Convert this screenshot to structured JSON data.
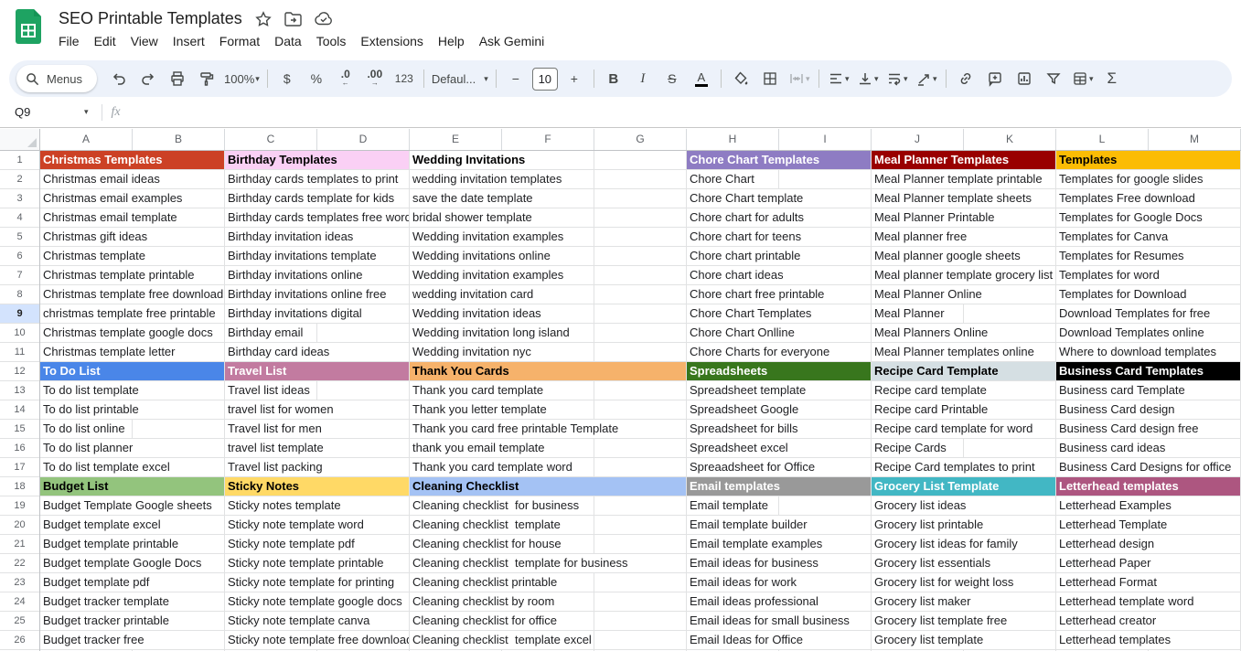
{
  "titlebar": {
    "title": "SEO Printable Templates",
    "menus": [
      "File",
      "Edit",
      "View",
      "Insert",
      "Format",
      "Data",
      "Tools",
      "Extensions",
      "Help",
      "Ask Gemini"
    ]
  },
  "toolbar": {
    "menus_label": "Menus",
    "zoom": "100%",
    "currency": "$",
    "percent": "%",
    "decrease_decimal": ".0",
    "increase_decimal": ".00",
    "more_formats": "123",
    "font_name": "Defaul...",
    "minus": "−",
    "font_size": "10",
    "plus": "+",
    "bold": "B",
    "italic": "I",
    "strikethrough": "S",
    "text_color": "A",
    "functions": "Σ"
  },
  "formula_bar": {
    "name_box": "Q9",
    "fx": "fx"
  },
  "grid": {
    "column_letters": [
      "A",
      "B",
      "C",
      "D",
      "E",
      "F",
      "G",
      "H",
      "I",
      "J",
      "K",
      "L",
      "M"
    ],
    "row_count": 26,
    "selected_row": 9,
    "groups": [
      {
        "col": 0,
        "span": 2,
        "headers": {
          "1": {
            "bg": "#cc4125",
            "fg": "#ffffff"
          },
          "12": {
            "bg": "#4a86e8",
            "fg": "#ffffff"
          },
          "18": {
            "bg": "#93c47d",
            "fg": "#000000"
          }
        },
        "cells": [
          "Christmas Templates",
          "Christmas email ideas",
          "Christmas email examples",
          "Christmas email template",
          "Christmas gift ideas",
          "Christmas template",
          "Christmas template printable",
          "Christmas template free download",
          "christmas template free printable",
          "Christmas template google docs",
          "Christmas template letter",
          "To Do List",
          "To do list template",
          "To do list printable",
          "To do list online",
          "To do list planner",
          "To do list template excel",
          "Budget List",
          "Budget Template Google sheets",
          "Budget template excel",
          "Budget template printable",
          "Budget template Google Docs",
          "Budget template pdf",
          "Budget tracker template",
          "Budget tracker printable",
          "Budget tracker free"
        ]
      },
      {
        "col": 2,
        "span": 2,
        "headers": {
          "1": {
            "bg": "#fad0f5",
            "fg": "#000000"
          },
          "12": {
            "bg": "#c27ba0",
            "fg": "#ffffff"
          },
          "18": {
            "bg": "#ffd966",
            "fg": "#000000"
          }
        },
        "cells": [
          "Birthday Templates",
          "Birthday cards templates to print",
          "Birthday cards template for kids",
          "Birthday cards templates free word",
          "Birthday invitation ideas",
          "Birthday invitations template",
          "Birthday invitations online",
          "Birthday invitations online free",
          "Birthday invitations digital",
          "Birthday email",
          "Birthday card ideas",
          "Travel List",
          "Travel list ideas",
          "travel list for women",
          "Travel list for men",
          "travel list template",
          "Travel list packing",
          "Sticky Notes",
          "Sticky notes template",
          "Sticky note template word",
          "Sticky note template pdf",
          "Sticky note template printable",
          "Sticky note template for printing",
          "Sticky note template google docs",
          "Sticky note template canva",
          "Sticky note template free download"
        ]
      },
      {
        "col": 4,
        "span": 3,
        "headers": {
          "1": {
            "bg": "#ffffff",
            "fg": "#000000"
          },
          "12": {
            "bg": "#f6b26b",
            "fg": "#000000"
          },
          "18": {
            "bg": "#a4c2f4",
            "fg": "#000000"
          }
        },
        "cells": [
          "Wedding Invitations",
          "wedding invitation templates",
          "save the date template",
          "bridal shower template",
          "Wedding invitation examples",
          "Wedding invitations online",
          "Wedding invitation examples",
          "wedding invitation card",
          "Wedding invitation ideas",
          "Wedding invitation long island",
          "Wedding invitation nyc",
          "Thank You Cards",
          "Thank you card template",
          "Thank you letter template",
          "Thank you card free printable Template",
          "thank you email template",
          "Thank you card template word",
          "Cleaning Checklist",
          "Cleaning checklist  for business",
          "Cleaning checklist  template",
          "Cleaning checklist for house",
          "Cleaning checklist  template for business",
          "Cleaning checklist printable",
          "Cleaning checklist by room",
          "Cleaning checklist for office",
          "Cleaning checklist  template excel"
        ]
      },
      {
        "col": 7,
        "span": 2,
        "headers": {
          "1": {
            "bg": "#8e7cc3",
            "fg": "#ffffff"
          },
          "12": {
            "bg": "#38761d",
            "fg": "#ffffff"
          },
          "18": {
            "bg": "#999999",
            "fg": "#ffffff"
          }
        },
        "cells": [
          "Chore Chart Templates",
          "Chore Chart",
          "Chore Chart template",
          "Chore chart for adults",
          "Chore chart for teens",
          "Chore chart printable",
          "Chore chart ideas",
          "Chore chart free printable",
          "Chore Chart Templates",
          "Chore Chart Onlline",
          "Chore Charts for everyone",
          "Spreadsheets",
          "Spreadsheet template",
          "Spreadsheet Google",
          "Spreadsheet for bills",
          "Spreadsheet excel",
          "Spreaadsheet for Office",
          "Email templates",
          "Email template",
          "Email template builder",
          "Email template examples",
          "Email ideas for business",
          "Email ideas for work",
          "Email ideas professional",
          "Email ideas for small business",
          "Email Ideas for Office"
        ]
      },
      {
        "col": 9,
        "span": 2,
        "headers": {
          "1": {
            "bg": "#990000",
            "fg": "#ffffff"
          },
          "12": {
            "bg": "#d5dfe3",
            "fg": "#000000"
          },
          "18": {
            "bg": "#42b7c4",
            "fg": "#ffffff"
          }
        },
        "cells": [
          "Meal Planner Templates",
          "Meal Planner template printable",
          "Meal Planner template sheets",
          "Meal Planner Printable",
          "Meal planner free",
          "Meal planner google sheets",
          "Meal planner template grocery list",
          "Meal Planner Online",
          "Meal Planner",
          "Meal Planners Online",
          "Meal Planner templates online",
          "Recipe Card Template",
          "Recipe card template",
          "Recipe card Printable",
          "Recipe card template for word",
          "Recipe Cards",
          "Recipe Card templates to print",
          "Grocery List Template",
          "Grocery list ideas",
          "Grocery list printable",
          "Grocery list ideas for family",
          "Grocery list essentials",
          "Grocery list for weight loss",
          "Grocery list maker",
          "Grocery list template free",
          "Grocery list template"
        ]
      },
      {
        "col": 11,
        "span": 2,
        "headers": {
          "1": {
            "bg": "#fbbc04",
            "fg": "#000000"
          },
          "12": {
            "bg": "#000000",
            "fg": "#ffffff"
          },
          "18": {
            "bg": "#ad5680",
            "fg": "#ffffff"
          }
        },
        "cells": [
          "Templates",
          "Templates for google slides",
          "Templates Free download",
          "Templates for Google Docs",
          "Templates for Canva",
          "Templates for Resumes",
          "Templates for word",
          "Templates for Download",
          "Download Templates for free",
          "Download Templates online",
          "Where to download templates",
          "Business Card Templates",
          "Business card Template",
          "Business Card design",
          "Business Card design free",
          "Business card ideas",
          "Business Card Designs for office",
          "Letterhead templates",
          "Letterhead Examples",
          "Letterhead Template",
          "Letterhead design",
          "Letterhead Paper",
          "Letterhead Format",
          "Letterhead template word",
          "Letterhead creator",
          "Letterhead templates"
        ]
      }
    ]
  }
}
